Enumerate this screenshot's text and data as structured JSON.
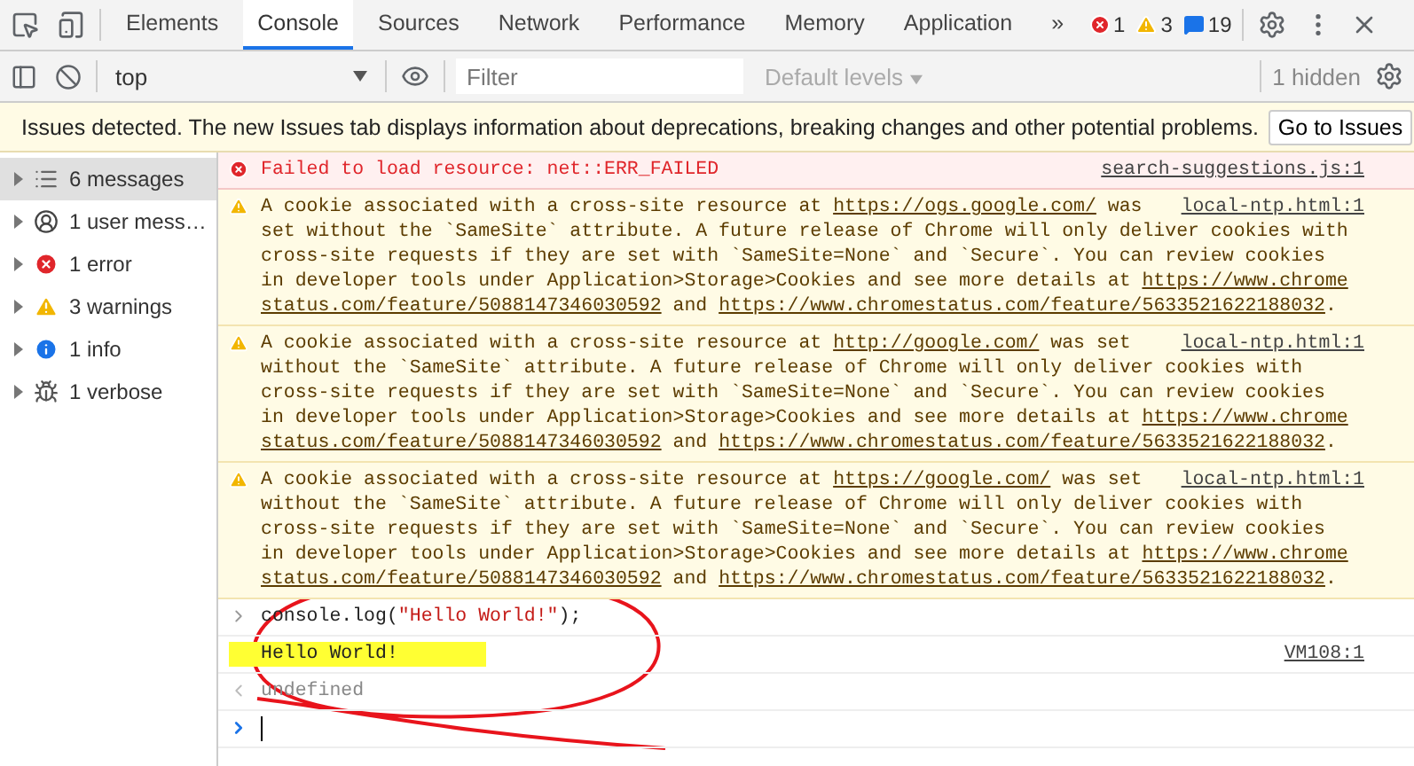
{
  "toolbar": {
    "tabs": [
      {
        "label": "Elements",
        "selected": false
      },
      {
        "label": "Console",
        "selected": true
      },
      {
        "label": "Sources",
        "selected": false
      },
      {
        "label": "Network",
        "selected": false
      },
      {
        "label": "Performance",
        "selected": false
      },
      {
        "label": "Memory",
        "selected": false
      },
      {
        "label": "Application",
        "selected": false
      }
    ],
    "more": "»",
    "counts": [
      {
        "kind": "error",
        "value": "1"
      },
      {
        "kind": "warning",
        "value": "3"
      },
      {
        "kind": "info",
        "value": "19"
      }
    ]
  },
  "console_toolbar": {
    "context": "top",
    "filter_placeholder": "Filter",
    "levels": "Default levels",
    "hidden": "1 hidden"
  },
  "issues_bar": {
    "text": "Issues detected. The new Issues tab displays information about deprecations, breaking changes and other potential problems.",
    "button": "Go to Issues"
  },
  "sidebar": {
    "items": [
      {
        "kind": "list",
        "label": "6 messages",
        "selected": true
      },
      {
        "kind": "user",
        "label": "1 user mess…",
        "selected": false
      },
      {
        "kind": "error",
        "label": "1 error",
        "selected": false
      },
      {
        "kind": "warning",
        "label": "3 warnings",
        "selected": false
      },
      {
        "kind": "info",
        "label": "1 info",
        "selected": false
      },
      {
        "kind": "verbose",
        "label": "1 verbose",
        "selected": false
      }
    ]
  },
  "console": {
    "entries": [
      {
        "kind": "error",
        "source": "search-suggestions.js:1",
        "lines": [
          [
            {
              "text": "Failed to load resource: net::ERR_FAILED"
            }
          ]
        ]
      },
      {
        "kind": "warning",
        "source": "local-ntp.html:1",
        "lines": [
          [
            {
              "text": "A cookie associated with a cross-site resource at "
            },
            {
              "text": "https://ogs.google.com/",
              "link": true
            },
            {
              "text": " was"
            }
          ],
          [
            {
              "text": "set without the `SameSite` attribute. A future release of Chrome will only deliver cookies with"
            }
          ],
          [
            {
              "text": "cross-site requests if they are set with `SameSite=None` and `Secure`. You can review cookies"
            }
          ],
          [
            {
              "text": "in developer tools under Application>Storage>Cookies and see more details at "
            },
            {
              "text": "https://www.chrome",
              "link": true
            }
          ],
          [
            {
              "text": "status.com/feature/5088147346030592",
              "link": true
            },
            {
              "text": " and "
            },
            {
              "text": "https://www.chromestatus.com/feature/5633521622188032",
              "link": true
            },
            {
              "text": "."
            }
          ]
        ]
      },
      {
        "kind": "warning",
        "source": "local-ntp.html:1",
        "lines": [
          [
            {
              "text": "A cookie associated with a cross-site resource at "
            },
            {
              "text": "http://google.com/",
              "link": true
            },
            {
              "text": " was set"
            }
          ],
          [
            {
              "text": "without the `SameSite` attribute. A future release of Chrome will only deliver cookies with"
            }
          ],
          [
            {
              "text": "cross-site requests if they are set with `SameSite=None` and `Secure`. You can review cookies"
            }
          ],
          [
            {
              "text": "in developer tools under Application>Storage>Cookies and see more details at "
            },
            {
              "text": "https://www.chrome",
              "link": true
            }
          ],
          [
            {
              "text": "status.com/feature/5088147346030592",
              "link": true
            },
            {
              "text": " and "
            },
            {
              "text": "https://www.chromestatus.com/feature/5633521622188032",
              "link": true
            },
            {
              "text": "."
            }
          ]
        ]
      },
      {
        "kind": "warning",
        "source": "local-ntp.html:1",
        "lines": [
          [
            {
              "text": "A cookie associated with a cross-site resource at "
            },
            {
              "text": "https://google.com/",
              "link": true
            },
            {
              "text": " was set"
            }
          ],
          [
            {
              "text": "without the `SameSite` attribute. A future release of Chrome will only deliver cookies with"
            }
          ],
          [
            {
              "text": "cross-site requests if they are set with `SameSite=None` and `Secure`. You can review cookies"
            }
          ],
          [
            {
              "text": "in developer tools under Application>Storage>Cookies and see more details at "
            },
            {
              "text": "https://www.chrome",
              "link": true
            }
          ],
          [
            {
              "text": "status.com/feature/5088147346030592",
              "link": true
            },
            {
              "text": " and "
            },
            {
              "text": "https://www.chromestatus.com/feature/5633521622188032",
              "link": true
            },
            {
              "text": "."
            }
          ]
        ]
      },
      {
        "kind": "input",
        "lines": [
          [
            {
              "text": "console.log("
            },
            {
              "text": "\"Hello World!\"",
              "string": true
            },
            {
              "text": ");"
            }
          ]
        ]
      },
      {
        "kind": "log",
        "source": "VM108:1",
        "highlighted": true,
        "lines": [
          [
            {
              "text": "Hello World!"
            }
          ]
        ]
      },
      {
        "kind": "result",
        "lines": [
          [
            {
              "text": "undefined"
            }
          ]
        ]
      },
      {
        "kind": "prompt"
      }
    ]
  }
}
